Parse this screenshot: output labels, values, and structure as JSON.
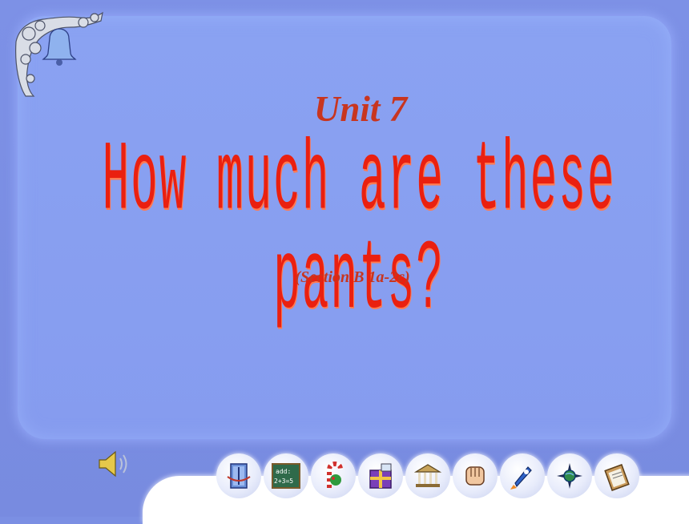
{
  "slide": {
    "unit_title": "Unit 7",
    "main_title": "How much are these pants?",
    "subtitle": "(Section B 1a-2c)"
  },
  "nav": {
    "buttons": [
      {
        "name": "book-icon"
      },
      {
        "name": "math-board-icon",
        "text_line1": "add:",
        "text_line2": "2+3=5"
      },
      {
        "name": "candy-cane-icon"
      },
      {
        "name": "gift-box-icon"
      },
      {
        "name": "museum-icon"
      },
      {
        "name": "fist-icon"
      },
      {
        "name": "rocket-icon"
      },
      {
        "name": "globe-compass-icon"
      },
      {
        "name": "clipboard-icon"
      }
    ]
  },
  "colors": {
    "background": "#7b8fe3",
    "panel": "#879eef",
    "title_red": "#ea2010",
    "unit_red": "#c8351f"
  }
}
